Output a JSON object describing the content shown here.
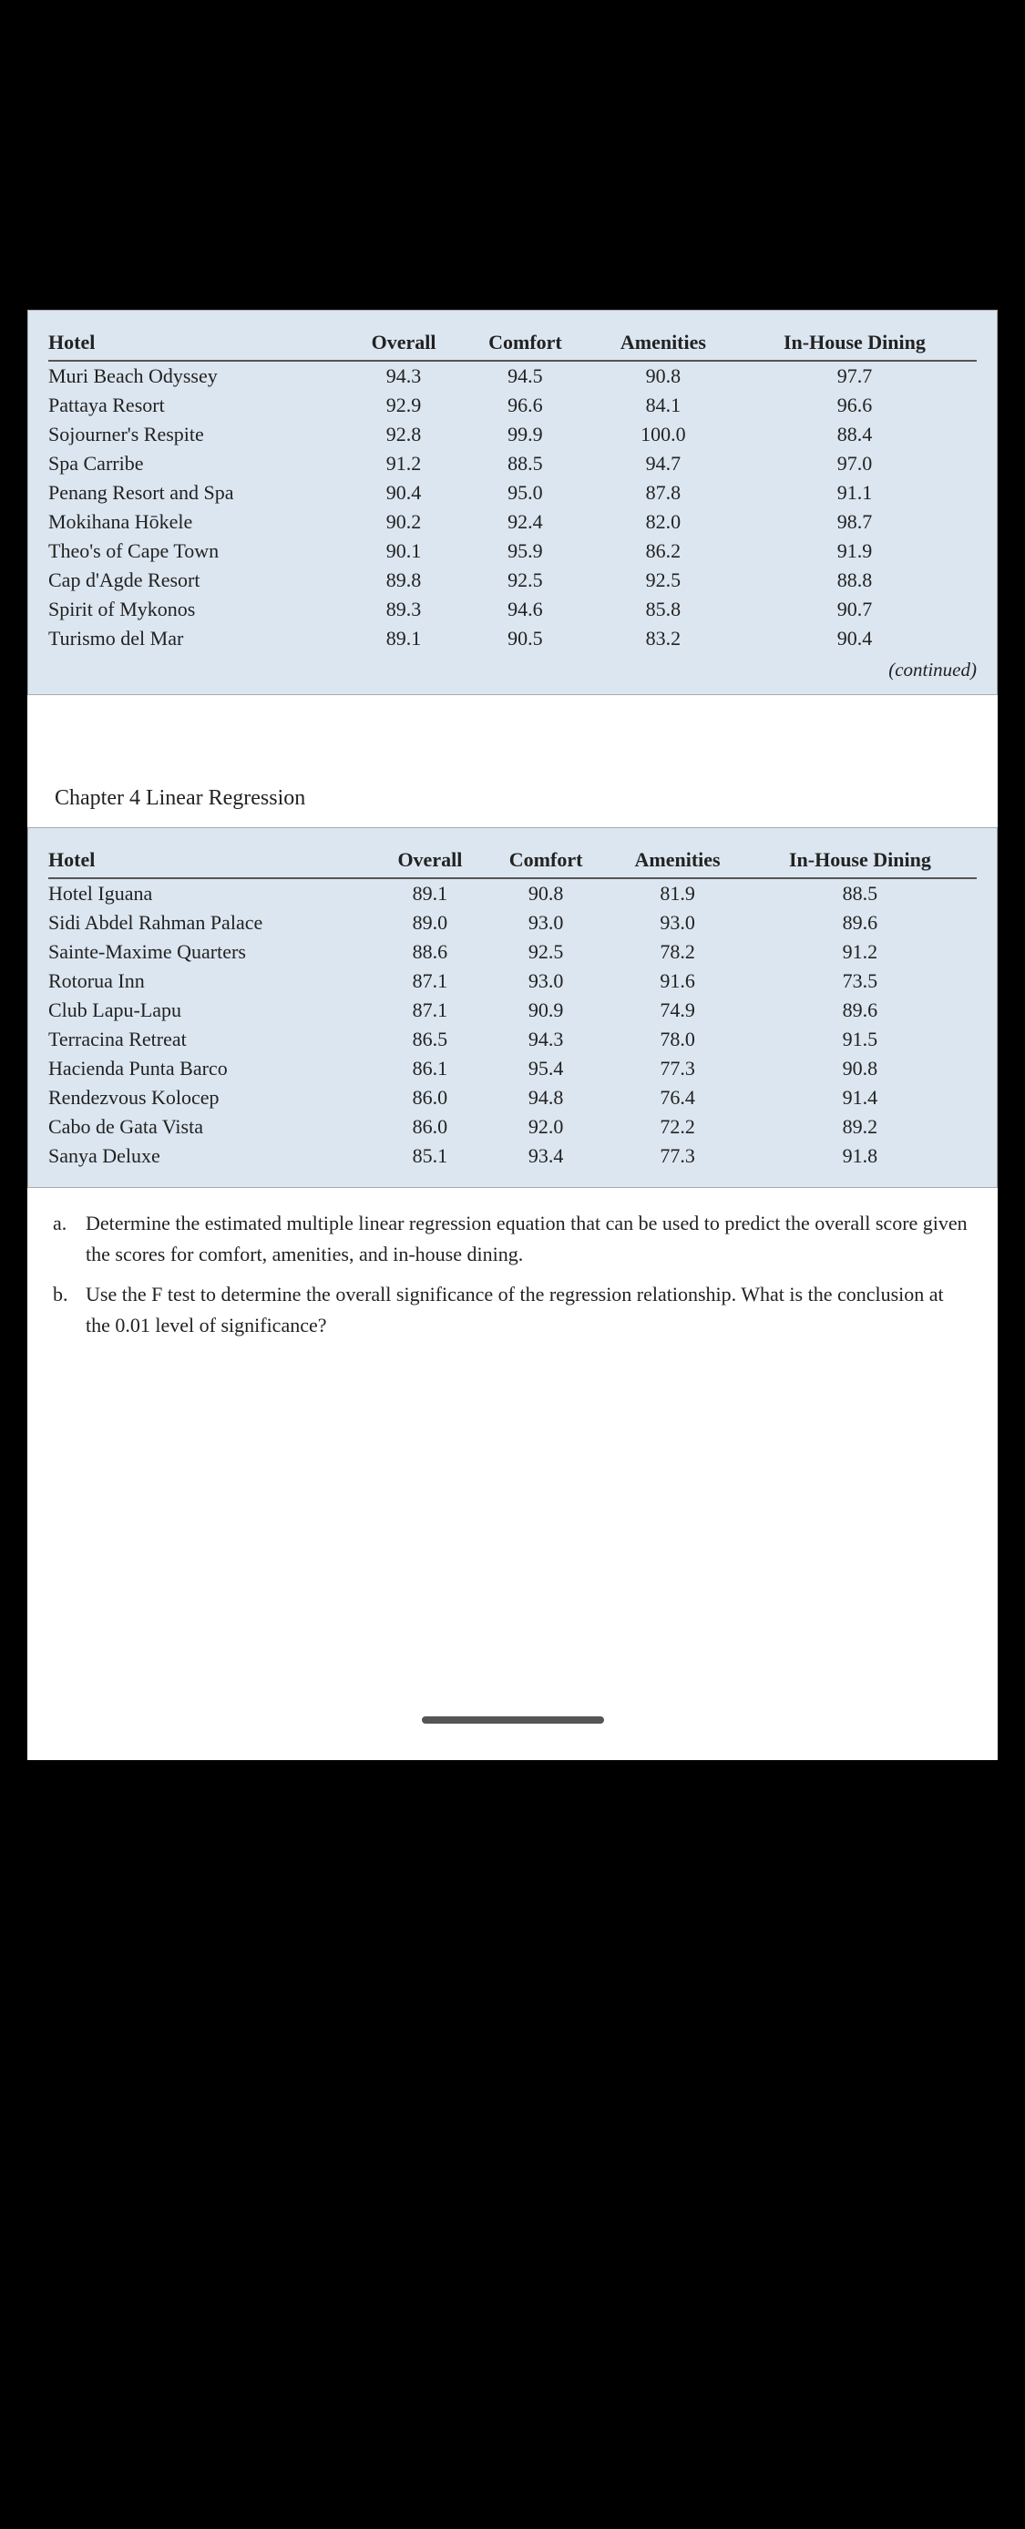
{
  "table1": {
    "columns": [
      "Hotel",
      "Overall",
      "Comfort",
      "Amenities",
      "In-House Dining"
    ],
    "rows": [
      [
        "Muri Beach Odyssey",
        "94.3",
        "94.5",
        "90.8",
        "97.7"
      ],
      [
        "Pattaya Resort",
        "92.9",
        "96.6",
        "84.1",
        "96.6"
      ],
      [
        "Sojourner's Respite",
        "92.8",
        "99.9",
        "100.0",
        "88.4"
      ],
      [
        "Spa Carribe",
        "91.2",
        "88.5",
        "94.7",
        "97.0"
      ],
      [
        "Penang Resort and Spa",
        "90.4",
        "95.0",
        "87.8",
        "91.1"
      ],
      [
        "Mokihana Hōkele",
        "90.2",
        "92.4",
        "82.0",
        "98.7"
      ],
      [
        "Theo's of Cape Town",
        "90.1",
        "95.9",
        "86.2",
        "91.9"
      ],
      [
        "Cap d'Agde Resort",
        "89.8",
        "92.5",
        "92.5",
        "88.8"
      ],
      [
        "Spirit of Mykonos",
        "89.3",
        "94.6",
        "85.8",
        "90.7"
      ],
      [
        "Turismo del Mar",
        "89.1",
        "90.5",
        "83.2",
        "90.4"
      ]
    ],
    "continued": "(continued)"
  },
  "chapter_header": "Chapter 4   Linear Regression",
  "table2": {
    "columns": [
      "Hotel",
      "Overall",
      "Comfort",
      "Amenities",
      "In-House Dining"
    ],
    "rows": [
      [
        "Hotel Iguana",
        "89.1",
        "90.8",
        "81.9",
        "88.5"
      ],
      [
        "Sidi Abdel Rahman Palace",
        "89.0",
        "93.0",
        "93.0",
        "89.6"
      ],
      [
        "Sainte-Maxime Quarters",
        "88.6",
        "92.5",
        "78.2",
        "91.2"
      ],
      [
        "Rotorua Inn",
        "87.1",
        "93.0",
        "91.6",
        "73.5"
      ],
      [
        "Club Lapu-Lapu",
        "87.1",
        "90.9",
        "74.9",
        "89.6"
      ],
      [
        "Terracina Retreat",
        "86.5",
        "94.3",
        "78.0",
        "91.5"
      ],
      [
        "Hacienda Punta Barco",
        "86.1",
        "95.4",
        "77.3",
        "90.8"
      ],
      [
        "Rendezvous Kolocep",
        "86.0",
        "94.8",
        "76.4",
        "91.4"
      ],
      [
        "Cabo de Gata Vista",
        "86.0",
        "92.0",
        "72.2",
        "89.2"
      ],
      [
        "Sanya Deluxe",
        "85.1",
        "93.4",
        "77.3",
        "91.8"
      ]
    ]
  },
  "questions": [
    {
      "label": "a.",
      "text": "Determine the estimated multiple linear regression equation that can be used to predict the overall score given the scores for comfort, amenities, and in-house dining."
    },
    {
      "label": "b.",
      "text": "Use the F test to determine the overall significance of the regression relationship. What is the conclusion at the 0.01 level of significance?"
    }
  ]
}
